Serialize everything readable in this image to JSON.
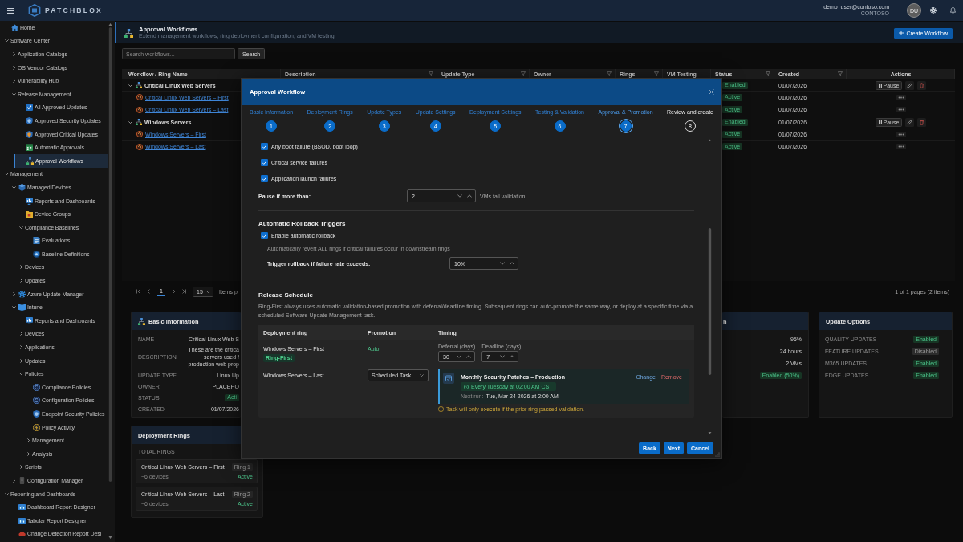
{
  "header": {
    "brand": "PATCHBLOX",
    "user_email": "demo_user@contoso.com",
    "tenant": "CONTOSO",
    "avatar_initials": "DU"
  },
  "sidebar": {
    "items": [
      {
        "label": "Home",
        "kind": "house",
        "selected": false
      },
      {
        "label": "Software Center",
        "kind": "plain",
        "selected": false,
        "expanded": true,
        "children": [
          {
            "label": "Application Catalogs",
            "kind": "plain",
            "selected": false,
            "expanded": false
          },
          {
            "label": "OS Vendor Catalogs",
            "kind": "plain",
            "selected": false,
            "expanded": false
          },
          {
            "label": "Vulnerability Hub",
            "kind": "plain",
            "selected": false,
            "expanded": false
          },
          {
            "label": "Release Management",
            "kind": "plain",
            "selected": false,
            "expanded": true,
            "children": [
              {
                "label": "All Approved Updates",
                "kind": "check",
                "selected": false
              },
              {
                "label": "Approved Security Updates",
                "kind": "shield",
                "selected": false
              },
              {
                "label": "Approved Critical Updates",
                "kind": "warnshield",
                "selected": false
              },
              {
                "label": "Automatic Approvals",
                "kind": "calendar",
                "selected": false
              },
              {
                "label": "Approval Workflows",
                "kind": "hierarchy",
                "selected": true
              }
            ]
          }
        ]
      },
      {
        "label": "Management",
        "kind": "plain",
        "selected": false,
        "expanded": true,
        "children": [
          {
            "label": "Managed Devices",
            "kind": "cube",
            "selected": false,
            "expanded": true,
            "children": [
              {
                "label": "Reports and Dashboards",
                "kind": "monitor",
                "selected": false
              },
              {
                "label": "Device Groups",
                "kind": "folder",
                "selected": false
              },
              {
                "label": "Compliance Baselines",
                "kind": "plain",
                "selected": false,
                "expanded": true,
                "children": [
                  {
                    "label": "Evaluations",
                    "kind": "document",
                    "selected": false
                  },
                  {
                    "label": "Baseline Definitions",
                    "kind": "target",
                    "selected": false
                  }
                ]
              },
              {
                "label": "Devices",
                "kind": "plain",
                "selected": false,
                "expanded": false
              },
              {
                "label": "Updates",
                "kind": "plain",
                "selected": false,
                "expanded": false
              }
            ]
          },
          {
            "label": "Azure Update Manager",
            "kind": "gear",
            "selected": false,
            "expanded": false
          },
          {
            "label": "Intune",
            "kind": "banner",
            "selected": false,
            "expanded": true,
            "children": [
              {
                "label": "Reports and Dashboards",
                "kind": "monitor",
                "selected": false
              },
              {
                "label": "Devices",
                "kind": "plain",
                "selected": false,
                "expanded": false
              },
              {
                "label": "Applications",
                "kind": "plain",
                "selected": false,
                "expanded": false
              },
              {
                "label": "Updates",
                "kind": "plain",
                "selected": false,
                "expanded": false
              },
              {
                "label": "Policies",
                "kind": "plain",
                "selected": false,
                "expanded": true,
                "children": [
                  {
                    "label": "Compliance Policies",
                    "kind": "disc",
                    "selected": false
                  },
                  {
                    "label": "Configuration Policies",
                    "kind": "disc",
                    "selected": false
                  },
                  {
                    "label": "Endpoint Security Policies",
                    "kind": "shield",
                    "selected": false
                  },
                  {
                    "label": "Policy Activity",
                    "kind": "bolt",
                    "selected": false
                  },
                  {
                    "label": "Management",
                    "kind": "plain",
                    "selected": false,
                    "expanded": false
                  },
                  {
                    "label": "Analysis",
                    "kind": "plain",
                    "selected": false,
                    "expanded": false
                  }
                ]
              },
              {
                "label": "Scripts",
                "kind": "plain",
                "selected": false,
                "expanded": false
              }
            ]
          },
          {
            "label": "Configuration Manager",
            "kind": "server",
            "selected": false,
            "expanded": false
          }
        ]
      },
      {
        "label": "Reporting and Dashboards",
        "kind": "plain",
        "selected": false,
        "expanded": true,
        "children": [
          {
            "label": "Dashboard Report Designer",
            "kind": "chart",
            "selected": false
          },
          {
            "label": "Tabular Report Designer",
            "kind": "chart",
            "selected": false
          },
          {
            "label": "Change Detection Report Desi",
            "kind": "cloud",
            "selected": false
          }
        ]
      }
    ]
  },
  "page": {
    "title": "Approval Workflows",
    "subtitle": "Extend management workflows, ring deployment configuration, and VM testing",
    "create_button": "Create Workflow",
    "search": {
      "placeholder": "Search workflows...",
      "button": "Search"
    }
  },
  "table": {
    "columns": [
      {
        "label": "Workflow / Ring Name",
        "filter": false
      },
      {
        "label": "Description",
        "filter": true
      },
      {
        "label": "Update Type",
        "filter": true
      },
      {
        "label": "Owner",
        "filter": true
      },
      {
        "label": "Rings",
        "filter": true
      },
      {
        "label": "VM Testing",
        "filter": false
      },
      {
        "label": "Status",
        "filter": true
      },
      {
        "label": "Created",
        "filter": true
      },
      {
        "label": "Actions",
        "filter": false
      }
    ],
    "rows": [
      {
        "name": "Critical Linux Web Servers",
        "expanded": true,
        "status": "Enabled",
        "created": "01/07/2026",
        "pause": "Pause",
        "children": [
          {
            "name": "Critical Linux Web Servers – First",
            "status": "Active",
            "created": "01/07/2026"
          },
          {
            "name": "Critical Linux Web Servers – Last",
            "status": "Active",
            "created": "01/07/2026"
          }
        ]
      },
      {
        "name": "Windows Servers",
        "expanded": true,
        "status": "Enabled",
        "created": "01/07/2026",
        "pause": "Pause",
        "children": [
          {
            "name": "Windows Servers – First",
            "status": "Active",
            "created": "01/07/2026"
          },
          {
            "name": "Windows Servers – Last",
            "status": "Active",
            "created": "01/07/2026"
          }
        ]
      }
    ]
  },
  "pagination": {
    "pages": [
      {
        "label": "1",
        "selected": true
      }
    ],
    "page_size": "15",
    "page_size_label": "Items p",
    "summary": "1 of 1 pages (2 items)"
  },
  "basic_information_card": {
    "title": "Basic Information",
    "fields": [
      {
        "label": "NAME",
        "value": "Critical Linux Web S",
        "kind": "text"
      },
      {
        "label": "DESCRIPTION",
        "value": "These are the critica\nservers used f\nproduction web prop",
        "kind": "text"
      },
      {
        "label": "UPDATE TYPE",
        "value": "Linux Up",
        "kind": "text"
      },
      {
        "label": "OWNER",
        "value": "PLACEHO",
        "kind": "text"
      },
      {
        "label": "STATUS",
        "value": "Acti",
        "kind": "badge"
      },
      {
        "label": "CREATED",
        "value": "01/07/2026",
        "kind": "text"
      }
    ]
  },
  "card_3": {
    "title": "n",
    "values": [
      {
        "value": "95%",
        "kind": "text"
      },
      {
        "value": "24 hours",
        "kind": "text"
      },
      {
        "value": "2 VMs",
        "kind": "text"
      },
      {
        "value": "Enabled (50%)",
        "kind": "badge"
      }
    ]
  },
  "update_options_card": {
    "title": "Update Options",
    "options": [
      {
        "label": "QUALITY UPDATES",
        "status": "Enabled",
        "enabled": true
      },
      {
        "label": "FEATURE UPDATES",
        "status": "Disabled",
        "enabled": false
      },
      {
        "label": "M365 UPDATES",
        "status": "Enabled",
        "enabled": true
      },
      {
        "label": "EDGE UPDATES",
        "status": "Enabled",
        "enabled": true
      }
    ]
  },
  "deployment_rings_card": {
    "title": "Deployment Rings",
    "total_label": "TOTAL RINGS",
    "rings": [
      {
        "name": "Critical Linux Web Servers – First",
        "badge": "Ring 1",
        "devices": "~6 devices",
        "status": "Active"
      },
      {
        "name": "Critical Linux Web Servers – Last",
        "badge": "Ring 2",
        "devices": "~6 devices",
        "status": "Active"
      }
    ]
  },
  "modal": {
    "title": "Approval Workflow",
    "steps": [
      {
        "label": "Basic Information",
        "number": "1",
        "completed": true,
        "selected": false
      },
      {
        "label": "Deployment Rings",
        "number": "2",
        "completed": true,
        "selected": false
      },
      {
        "label": "Update Types",
        "number": "3",
        "completed": true,
        "selected": false
      },
      {
        "label": "Update Settings",
        "number": "4",
        "completed": true,
        "selected": false
      },
      {
        "label": "Deployment Settings",
        "number": "5",
        "completed": true,
        "selected": false
      },
      {
        "label": "Testing & Validation",
        "number": "6",
        "completed": true,
        "selected": false
      },
      {
        "label": "Approval & Promotion",
        "number": "7",
        "completed": false,
        "selected": true
      },
      {
        "label": "Review and create",
        "number": "8",
        "completed": false,
        "selected": false
      }
    ],
    "failure_checks": [
      {
        "label": "Any boot failure (BSOD, boot loop)",
        "checked": true
      },
      {
        "label": "Critical service failures",
        "checked": true
      },
      {
        "label": "Application launch failures",
        "checked": true
      }
    ],
    "pause_threshold": {
      "label": "Pause if more than:",
      "value": "2",
      "suffix": "VMs fail validation"
    },
    "rollback": {
      "heading": "Automatic Rollback Triggers",
      "enable": {
        "label": "Enable automatic rollback",
        "checked": true
      },
      "description": "Automatically revert ALL rings if critical failures occur in downstream rings",
      "threshold": {
        "label": "Trigger rollback if failure rate exceeds:",
        "value": "10%"
      }
    },
    "release_schedule": {
      "heading": "Release Schedule",
      "description": "Ring-First always uses automatic validation-based promotion with deferral/deadline timing. Subsequent rings can auto-promote the same way, or deploy at a specific time via a scheduled Software Update Management task.",
      "columns": [
        "Deployment ring",
        "Promotion",
        "Timing"
      ],
      "rows": [
        {
          "kind": "auto",
          "ring": "Windows Servers – First",
          "badge": "Ring-First",
          "promotion": "Auto",
          "deferral": {
            "label": "Deferral (days)",
            "value": "30"
          },
          "deadline": {
            "label": "Deadline (days)",
            "value": "7"
          }
        },
        {
          "kind": "scheduled",
          "ring": "Windows Servers – Last",
          "promotion": "Scheduled Task",
          "task": {
            "name": "Monthly Security Patches – Production",
            "change": "Change",
            "remove": "Remove",
            "recurrence": "Every Tuesday at 02:00 AM CST",
            "next_run_label": "Next run:",
            "next_run": "Tue, Mar 24 2026 at 2:00 AM"
          },
          "note": "Task will only execute if the prior ring passed validation."
        }
      ]
    },
    "buttons": [
      "Back",
      "Next",
      "Cancel"
    ]
  }
}
